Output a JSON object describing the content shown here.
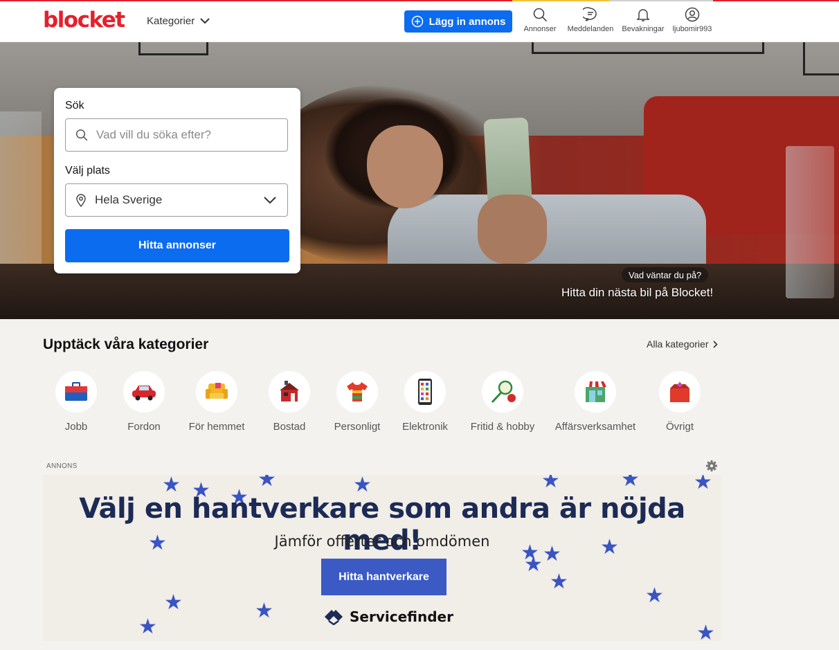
{
  "header": {
    "logo": "blocket",
    "categories_label": "Kategorier",
    "post_button": "Lägg in annons",
    "nav": [
      {
        "label": "Annonser",
        "icon": "search-icon"
      },
      {
        "label": "Meddelanden",
        "icon": "chat-icon"
      },
      {
        "label": "Bevakningar",
        "icon": "bell-icon"
      },
      {
        "label": "ljubomir993",
        "icon": "user-icon"
      }
    ]
  },
  "search": {
    "search_label": "Sök",
    "search_placeholder": "Vad vill du söka efter?",
    "location_label": "Välj plats",
    "location_value": "Hela Sverige",
    "submit_label": "Hitta annonser"
  },
  "hero": {
    "badge": "Vad väntar du på?",
    "cta": "Hitta din nästa bil på Blocket!"
  },
  "categories": {
    "title": "Upptäck våra kategorier",
    "all_link": "Alla kategorier",
    "items": [
      {
        "label": "Jobb",
        "icon": "briefcase-icon"
      },
      {
        "label": "Fordon",
        "icon": "car-icon"
      },
      {
        "label": "För hemmet",
        "icon": "armchair-icon"
      },
      {
        "label": "Bostad",
        "icon": "house-icon"
      },
      {
        "label": "Personligt",
        "icon": "tshirt-icon"
      },
      {
        "label": "Elektronik",
        "icon": "phone-icon"
      },
      {
        "label": "Fritid & hobby",
        "icon": "racket-icon"
      },
      {
        "label": "Affärsverksamhet",
        "icon": "shop-icon"
      },
      {
        "label": "Övrigt",
        "icon": "box-icon"
      }
    ]
  },
  "ad": {
    "label": "ANNONS",
    "headline": "Välj en hantverkare som andra är nöjda med!",
    "subline": "Jämför offerter och omdömen",
    "button": "Hitta hantverkare",
    "brand": "Servicefinder"
  },
  "colors": {
    "brand_red": "#e6202c",
    "primary_blue": "#0b6cf0",
    "ad_blue": "#3b5ac4",
    "ad_navy": "#1c2b55"
  }
}
